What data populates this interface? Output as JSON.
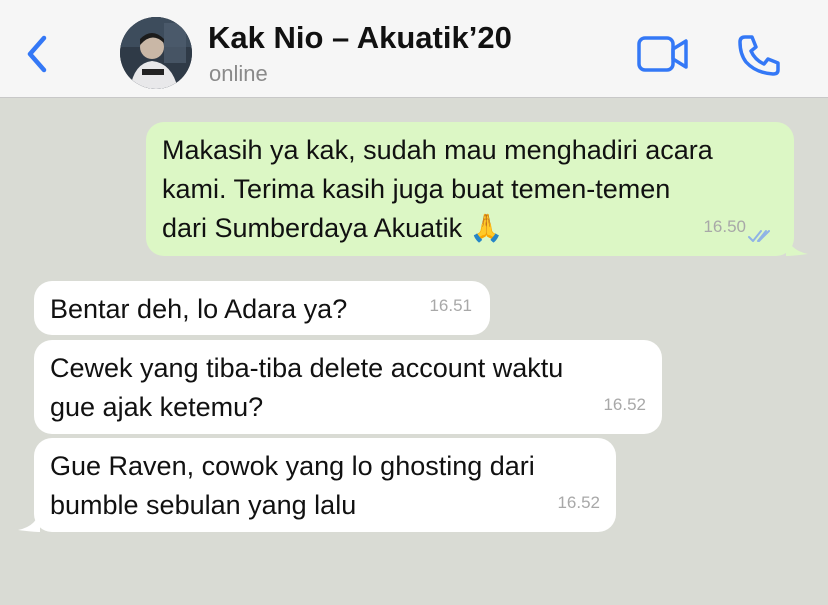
{
  "header": {
    "title": "Kak Nio – Akuatik’20",
    "status": "online",
    "back_icon": "chevron-left-icon",
    "video_icon": "video-camera-icon",
    "call_icon": "phone-icon",
    "accent_color": "#3478f6"
  },
  "messages": [
    {
      "direction": "outgoing",
      "lines": [
        "Makasih ya kak, sudah mau menghadiri acara",
        "kami. Terima kasih juga buat temen-temen",
        "dari Sumberdaya Akuatik 🙏"
      ],
      "time": "16.50",
      "status_icon": "double-check-icon"
    },
    {
      "direction": "incoming",
      "lines": [
        "Bentar deh, lo Adara ya?"
      ],
      "time": "16.51"
    },
    {
      "direction": "incoming",
      "lines": [
        "Cewek yang tiba-tiba delete account waktu",
        "gue ajak ketemu?"
      ],
      "time": "16.52"
    },
    {
      "direction": "incoming",
      "lines": [
        "Gue Raven, cowok yang lo ghosting dari",
        "bumble sebulan yang lalu"
      ],
      "time": "16.52"
    }
  ],
  "colors": {
    "background": "#d9dbd4",
    "outgoing_bubble": "#dcf7c5",
    "incoming_bubble": "#ffffff"
  }
}
